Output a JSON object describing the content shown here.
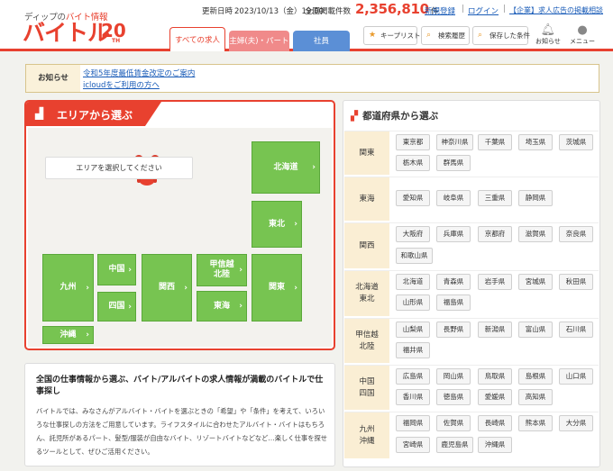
{
  "header": {
    "tagline_prefix": "ディップの",
    "tagline_highlight": "バイト情報",
    "logo_text": "バイトル",
    "logo_anniv": "20",
    "logo_th": "TH",
    "update_label": "更新日時",
    "update_value": "2023/10/13（金）19:00",
    "count_label": "全国掲載件数",
    "count_value": "2,356,810",
    "count_unit": "件",
    "register_link": "新規登録",
    "login_link": "ログイン",
    "corp_link": "【企業】求人広告の掲載相談",
    "tabs": [
      "すべての求人",
      "主婦(夫)・パート",
      "社員"
    ],
    "buttons": {
      "keeplist": "キープリスト",
      "history": "検索履歴",
      "saved": "保存した条件"
    },
    "notifications_label": "お知らせ",
    "menu_label": "メニュー"
  },
  "notice": {
    "label": "お知らせ",
    "links": [
      "令和5年度最低賃金改定のご案内",
      "icloudをご利用の方へ"
    ]
  },
  "area": {
    "title": "エリアから選ぶ",
    "select_prompt": "エリアを選択してください",
    "regions": {
      "hokkaido": "北海道",
      "tohoku": "東北",
      "koshinetsu": "甲信越\n北陸",
      "kanto": "関東",
      "chugoku": "中国",
      "shikoku": "四国",
      "kansai": "関西",
      "tokai": "東海",
      "kyushu": "九州",
      "okinawa": "沖縄"
    }
  },
  "description": {
    "title": "全国の仕事情報から選ぶ、バイト/アルバイトの求人情報が満載のバイトルで仕事探し",
    "body": "バイトルでは、みなさんがアルバイト・バイトを選ぶときの「希望」や「条件」を考えて、いろいろな仕事探しの方法をご用意しています。ライフスタイルに合わせたアルバイト・バイトはもちろん、託児所があるパート、髪型/服装が自由なバイト、リゾートバイトなどなど…楽しく仕事を探せるツールとして、ぜひご活用ください。"
  },
  "prefectures": {
    "title": "都道府県から選ぶ",
    "rows": [
      {
        "region": "関東",
        "items": [
          "東京都",
          "神奈川県",
          "千葉県",
          "埼玉県",
          "茨城県",
          "栃木県",
          "群馬県"
        ]
      },
      {
        "region": "東海",
        "items": [
          "愛知県",
          "岐阜県",
          "三重県",
          "静岡県"
        ]
      },
      {
        "region": "関西",
        "items": [
          "大阪府",
          "兵庫県",
          "京都府",
          "滋賀県",
          "奈良県",
          "和歌山県"
        ]
      },
      {
        "region": "北海道\n東北",
        "items": [
          "北海道",
          "青森県",
          "岩手県",
          "宮城県",
          "秋田県",
          "山形県",
          "福島県"
        ]
      },
      {
        "region": "甲信越\n北陸",
        "items": [
          "山梨県",
          "長野県",
          "新潟県",
          "富山県",
          "石川県",
          "福井県"
        ]
      },
      {
        "region": "中国\n四国",
        "items": [
          "広島県",
          "岡山県",
          "鳥取県",
          "島根県",
          "山口県",
          "香川県",
          "徳島県",
          "愛媛県",
          "高知県"
        ]
      },
      {
        "region": "九州\n沖縄",
        "items": [
          "福岡県",
          "佐賀県",
          "長崎県",
          "熊本県",
          "大分県",
          "宮崎県",
          "鹿児島県",
          "沖縄県"
        ]
      }
    ]
  },
  "colors": {
    "accent": "#e8412f",
    "region_green": "#77c451",
    "tab_pink": "#f08a8a",
    "tab_blue": "#5b8fd6"
  }
}
